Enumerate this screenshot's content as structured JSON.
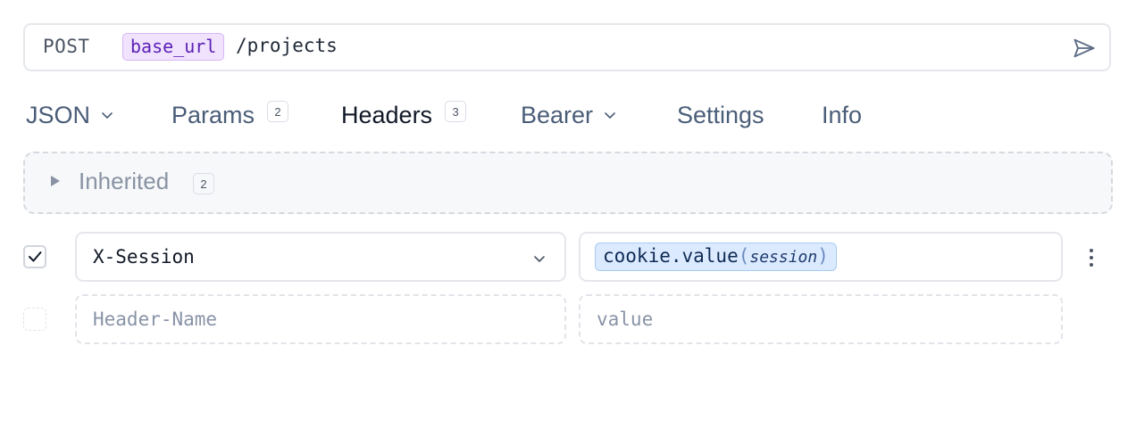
{
  "request": {
    "method": "POST",
    "url_variable": "base_url",
    "url_path": "/projects"
  },
  "tabs": [
    {
      "label": "JSON",
      "dropdown": true
    },
    {
      "label": "Params",
      "badge": "2"
    },
    {
      "label": "Headers",
      "badge": "3",
      "active": true
    },
    {
      "label": "Bearer",
      "dropdown": true
    },
    {
      "label": "Settings"
    },
    {
      "label": "Info"
    }
  ],
  "inherited": {
    "label": "Inherited",
    "count": "2"
  },
  "headers": [
    {
      "enabled": true,
      "name": "X-Session",
      "value_fn": "cookie.value",
      "value_arg": "session"
    }
  ],
  "new_header": {
    "name_placeholder": "Header-Name",
    "value_placeholder": "value"
  },
  "colors": {
    "variable_chip": "#f1e3fd",
    "function_chip": "#dbeafe",
    "accent_text": "#4a5d78"
  }
}
